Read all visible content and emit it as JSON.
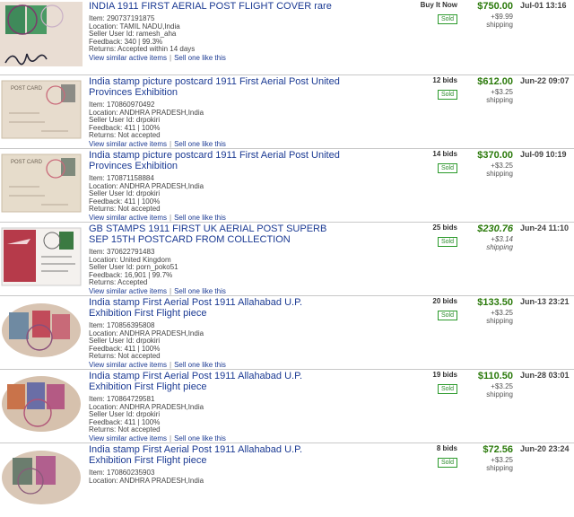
{
  "listings": [
    {
      "title": "INDIA 1911 FIRST AERIAL POST FLIGHT COVER rare",
      "item": "Item: 290737191875",
      "location": "Location: TAMIL NADU,India",
      "seller": "Seller User Id: ramesh_aha",
      "feedback": "Feedback: 340 | 99.3%",
      "returns": "Returns: Accepted within 14 days",
      "bids": "Buy It Now",
      "sold": "Sold",
      "price": "$750.00",
      "shipping_cost": "+$9.99",
      "shipping_label": "shipping",
      "date": "Jul-01 13:16",
      "link_similar": "View similar active items",
      "link_sell": "Sell one like this"
    },
    {
      "title": "India stamp picture postcard 1911 First Aerial Post United Provinces Exhibition",
      "item": "Item: 170860970492",
      "location": "Location: ANDHRA PRADESH,India",
      "seller": "Seller User Id: drpokiri",
      "feedback": "Feedback: 411 | 100%",
      "returns": "Returns: Not accepted",
      "bids": "12 bids",
      "sold": "Sold",
      "price": "$612.00",
      "shipping_cost": "+$3.25",
      "shipping_label": "shipping",
      "date": "Jun-22 09:07",
      "link_similar": "View similar active items",
      "link_sell": "Sell one like this"
    },
    {
      "title": "India stamp picture postcard 1911 First Aerial Post United Provinces Exhibition",
      "item": "Item: 170871158884",
      "location": "Location: ANDHRA PRADESH,India",
      "seller": "Seller User Id: drpokiri",
      "feedback": "Feedback: 411 | 100%",
      "returns": "Returns: Not accepted",
      "bids": "14 bids",
      "sold": "Sold",
      "price": "$370.00",
      "shipping_cost": "+$3.25",
      "shipping_label": "shipping",
      "date": "Jul-09 10:19",
      "link_similar": "View similar active items",
      "link_sell": "Sell one like this"
    },
    {
      "title": "GB STAMPS 1911 FIRST UK AERIAL POST SUPERB SEP 15TH POSTCARD FROM COLLECTION",
      "item": "Item: 370622791483",
      "location": "Location: United Kingdom",
      "seller": "Seller User Id: porn_poko51",
      "feedback": "Feedback: 16,901 | 99.7%",
      "returns": "Returns: Accepted",
      "bids": "25 bids",
      "sold": "Sold",
      "price": "$230.76",
      "shipping_cost": "+$3.14",
      "shipping_label": "shipping",
      "date": "Jun-24 11:10",
      "link_similar": "View similar active items",
      "link_sell": "Sell one like this"
    },
    {
      "title": "India stamp First Aerial Post 1911 Allahabad U.P. Exhibition First Flight piece",
      "item": "Item: 170856395808",
      "location": "Location: ANDHRA PRADESH,India",
      "seller": "Seller User Id: drpokiri",
      "feedback": "Feedback: 411 | 100%",
      "returns": "Returns: Not accepted",
      "bids": "20 bids",
      "sold": "Sold",
      "price": "$133.50",
      "shipping_cost": "+$3.25",
      "shipping_label": "shipping",
      "date": "Jun-13 23:21",
      "link_similar": "View similar active items",
      "link_sell": "Sell one like this"
    },
    {
      "title": "India stamp First Aerial Post 1911 Allahabad U.P. Exhibition First Flight piece",
      "item": "Item: 170864729581",
      "location": "Location: ANDHRA PRADESH,India",
      "seller": "Seller User Id: drpokiri",
      "feedback": "Feedback: 411 | 100%",
      "returns": "Returns: Not accepted",
      "bids": "19 bids",
      "sold": "Sold",
      "price": "$110.50",
      "shipping_cost": "+$3.25",
      "shipping_label": "shipping",
      "date": "Jun-28 03:01",
      "link_similar": "View similar active items",
      "link_sell": "Sell one like this"
    },
    {
      "title": "India stamp First Aerial Post 1911 Allahabad U.P. Exhibition First Flight piece",
      "item": "Item: 170860235903",
      "location": "Location: ANDHRA PRADESH,India",
      "seller": "",
      "feedback": "",
      "returns": "",
      "bids": "8 bids",
      "sold": "Sold",
      "price": "$72.56",
      "shipping_cost": "+$3.25",
      "shipping_label": "shipping",
      "date": "Jun-20 23:24",
      "link_similar": "",
      "link_sell": ""
    }
  ],
  "colors": {
    "link": "#1b3a93",
    "price": "#2b7a0b",
    "sold_border": "#2a9a2a"
  },
  "thumb_icons": [
    "cover-stamps-thumbnail",
    "postcard-thumbnail",
    "postcard-thumbnail",
    "aerial-postcard-thumbnail",
    "stamp-piece-thumbnail",
    "stamp-piece-thumbnail",
    "stamp-piece-thumbnail"
  ]
}
